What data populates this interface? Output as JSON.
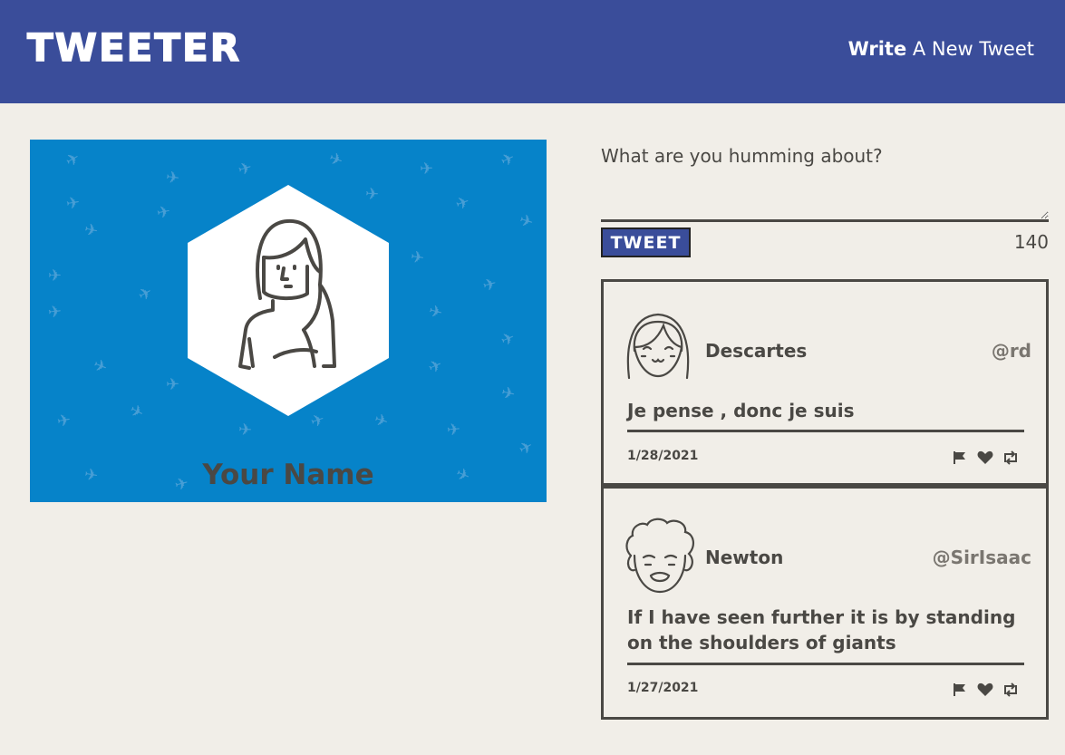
{
  "nav": {
    "brand": "TWEETER",
    "compose_bold": "Write",
    "compose_rest": " A New Tweet"
  },
  "profile": {
    "name": "Your Name"
  },
  "compose": {
    "placeholder": "What are you humming about?",
    "button_label": "TWEET",
    "counter": "140"
  },
  "tweets": [
    {
      "name": "Descartes",
      "handle": "@rd",
      "content": "Je pense , donc je suis",
      "date": "1/28/2021"
    },
    {
      "name": "Newton",
      "handle": "@SirIsaac",
      "content": "If I have seen further it is by standing on the shoulders of giants",
      "date": "1/27/2021"
    }
  ],
  "icons": [
    "flag-icon",
    "heart-icon",
    "retweet-icon"
  ],
  "colors": {
    "nav_bg": "#3a4d9a",
    "page_bg": "#f1eee8",
    "profile_bg": "#0683c9",
    "text": "#4a4844"
  }
}
